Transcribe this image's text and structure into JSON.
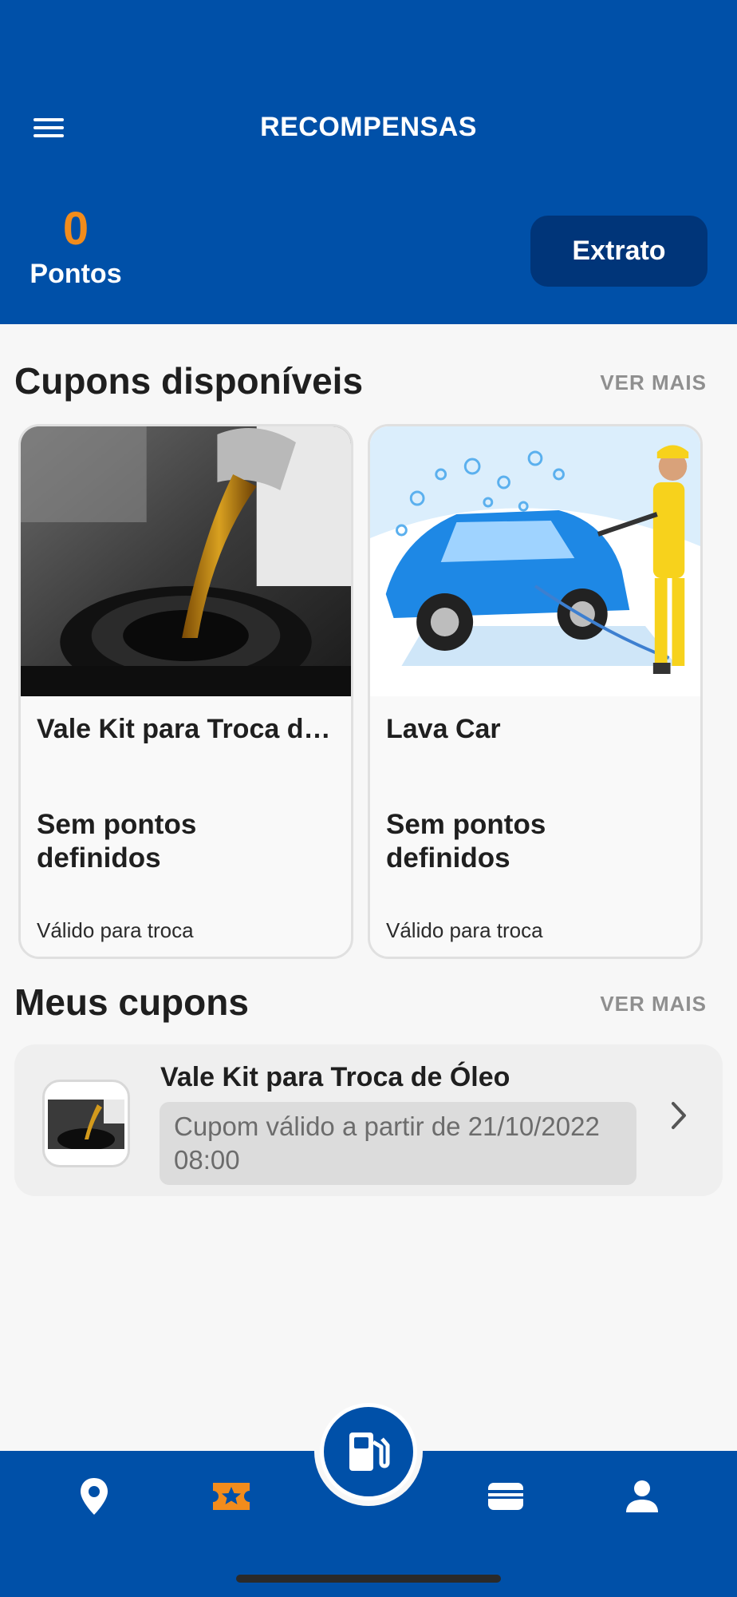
{
  "header": {
    "title": "RECOMPENSAS",
    "points_value": "0",
    "points_label": "Pontos",
    "statement_button": "Extrato"
  },
  "available": {
    "title": "Cupons disponíveis",
    "see_more": "VER MAIS",
    "cards": [
      {
        "title": "Vale Kit para Troca de Óleo",
        "points": "Sem pontos definidos",
        "validity": "Válido para troca",
        "image": "oil-change-photo"
      },
      {
        "title": "Lava Car",
        "points": "Sem pontos definidos",
        "validity": "Válido para troca",
        "image": "car-wash-illustration"
      }
    ]
  },
  "mine": {
    "title": "Meus cupons",
    "see_more": "VER MAIS",
    "items": [
      {
        "title": "Vale Kit para Troca de Óleo",
        "status": "Cupom válido a partir de 21/10/2022 08:00",
        "image": "oil-change-photo"
      }
    ]
  },
  "nav": {
    "items": [
      "map-pin-icon",
      "coupon-icon",
      "fuel-pump-icon",
      "wallet-card-icon",
      "profile-icon"
    ],
    "active": "coupon-icon"
  },
  "colors": {
    "primary": "#0050a8",
    "primary_dark": "#003579",
    "accent": "#f28c1c"
  }
}
